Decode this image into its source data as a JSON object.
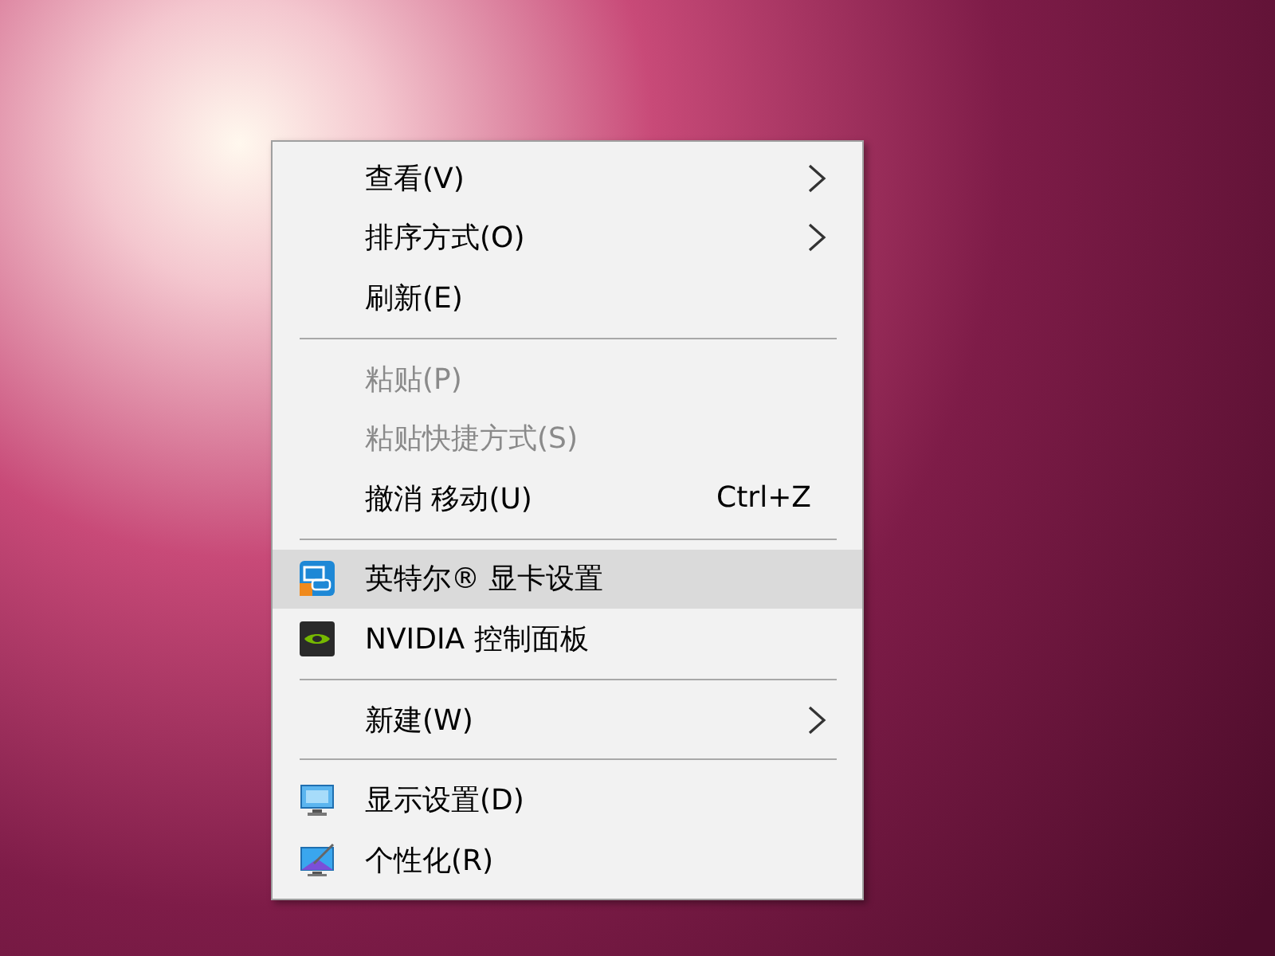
{
  "menu": {
    "groups": [
      {
        "items": [
          {
            "kind": "plain",
            "label": "查看(V)",
            "submenu": true,
            "disabled": false,
            "selected": false
          },
          {
            "kind": "plain",
            "label": "排序方式(O)",
            "submenu": true,
            "disabled": false,
            "selected": false
          },
          {
            "kind": "plain",
            "label": "刷新(E)",
            "submenu": false,
            "disabled": false,
            "selected": false
          }
        ]
      },
      {
        "items": [
          {
            "kind": "plain",
            "label": "粘贴(P)",
            "submenu": false,
            "disabled": true,
            "selected": false
          },
          {
            "kind": "plain",
            "label": "粘贴快捷方式(S)",
            "submenu": false,
            "disabled": true,
            "selected": false
          },
          {
            "kind": "plain",
            "label": "撤消 移动(U)",
            "shortcut": "Ctrl+Z",
            "submenu": false,
            "disabled": false,
            "selected": false
          }
        ]
      },
      {
        "items": [
          {
            "kind": "intel",
            "label": "英特尔® 显卡设置",
            "submenu": false,
            "disabled": false,
            "selected": true
          },
          {
            "kind": "nvidia",
            "label": "NVIDIA 控制面板",
            "submenu": false,
            "disabled": false,
            "selected": false
          }
        ]
      },
      {
        "items": [
          {
            "kind": "plain",
            "label": "新建(W)",
            "submenu": true,
            "disabled": false,
            "selected": false
          }
        ]
      },
      {
        "items": [
          {
            "kind": "display",
            "label": "显示设置(D)",
            "submenu": false,
            "disabled": false,
            "selected": false
          },
          {
            "kind": "personalize",
            "label": "个性化(R)",
            "submenu": false,
            "disabled": false,
            "selected": false
          }
        ]
      }
    ]
  }
}
